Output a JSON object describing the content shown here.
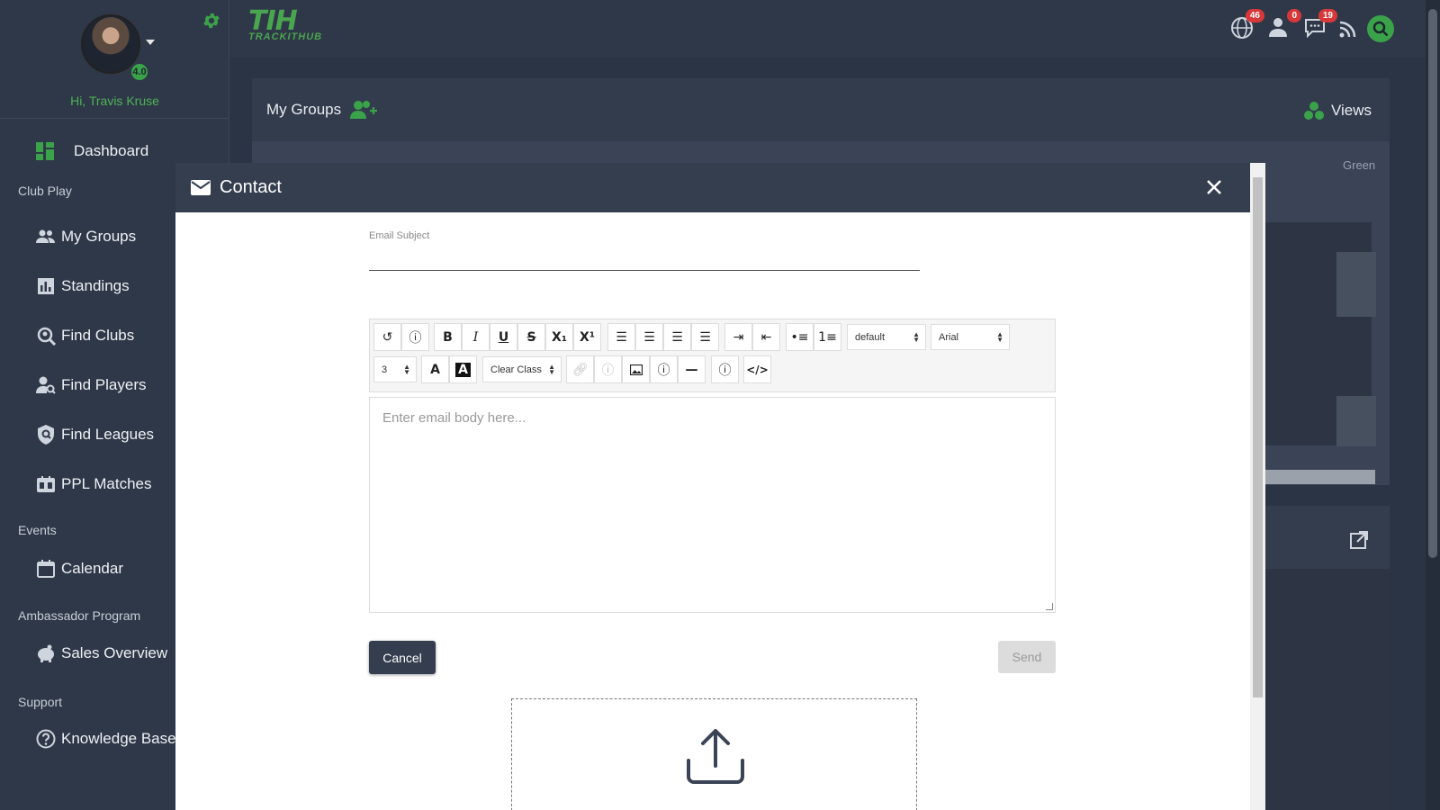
{
  "profile": {
    "greeting": "Hi, Travis Kruse",
    "rating": "4.0"
  },
  "sidebar": {
    "dashboard": "Dashboard",
    "sections": {
      "club_play": "Club Play",
      "events": "Events",
      "ambassador": "Ambassador Program",
      "support": "Support"
    },
    "items": [
      {
        "label": "My Groups",
        "icon": "people-icon"
      },
      {
        "label": "Standings",
        "icon": "bar-chart-icon"
      },
      {
        "label": "Find Clubs",
        "icon": "search-location-icon"
      },
      {
        "label": "Find Players",
        "icon": "user-search-icon"
      },
      {
        "label": "Find Leagues",
        "icon": "shield-search-icon"
      },
      {
        "label": "PPL Matches",
        "icon": "scoreboard-icon"
      },
      {
        "label": "Calendar",
        "icon": "calendar-icon"
      },
      {
        "label": "Sales Overview",
        "icon": "piggy-bank-icon"
      },
      {
        "label": "Knowledge Base",
        "icon": "help-circle-icon"
      }
    ]
  },
  "topbar": {
    "logo_mark": "TIH",
    "logo_text": "TRACKITHUB",
    "badges": {
      "globe": "46",
      "user": "0",
      "chat": "19"
    }
  },
  "groups_panel": {
    "title": "My Groups",
    "views": "Views",
    "green_label": "Green"
  },
  "modal": {
    "title": "Contact",
    "subject_label": "Email Subject",
    "subject_value": "",
    "body_placeholder": "Enter email body here...",
    "toolbar": {
      "paragraph_style": "default",
      "font_name": "Arial",
      "font_size": "3",
      "clear_class": "Clear Class"
    },
    "cancel_label": "Cancel",
    "send_label": "Send"
  },
  "colors": {
    "brand_green": "#3aa34a",
    "sidebar_bg": "#2f3848",
    "modal_header": "#343e4f",
    "badge_red": "#d9383a"
  }
}
